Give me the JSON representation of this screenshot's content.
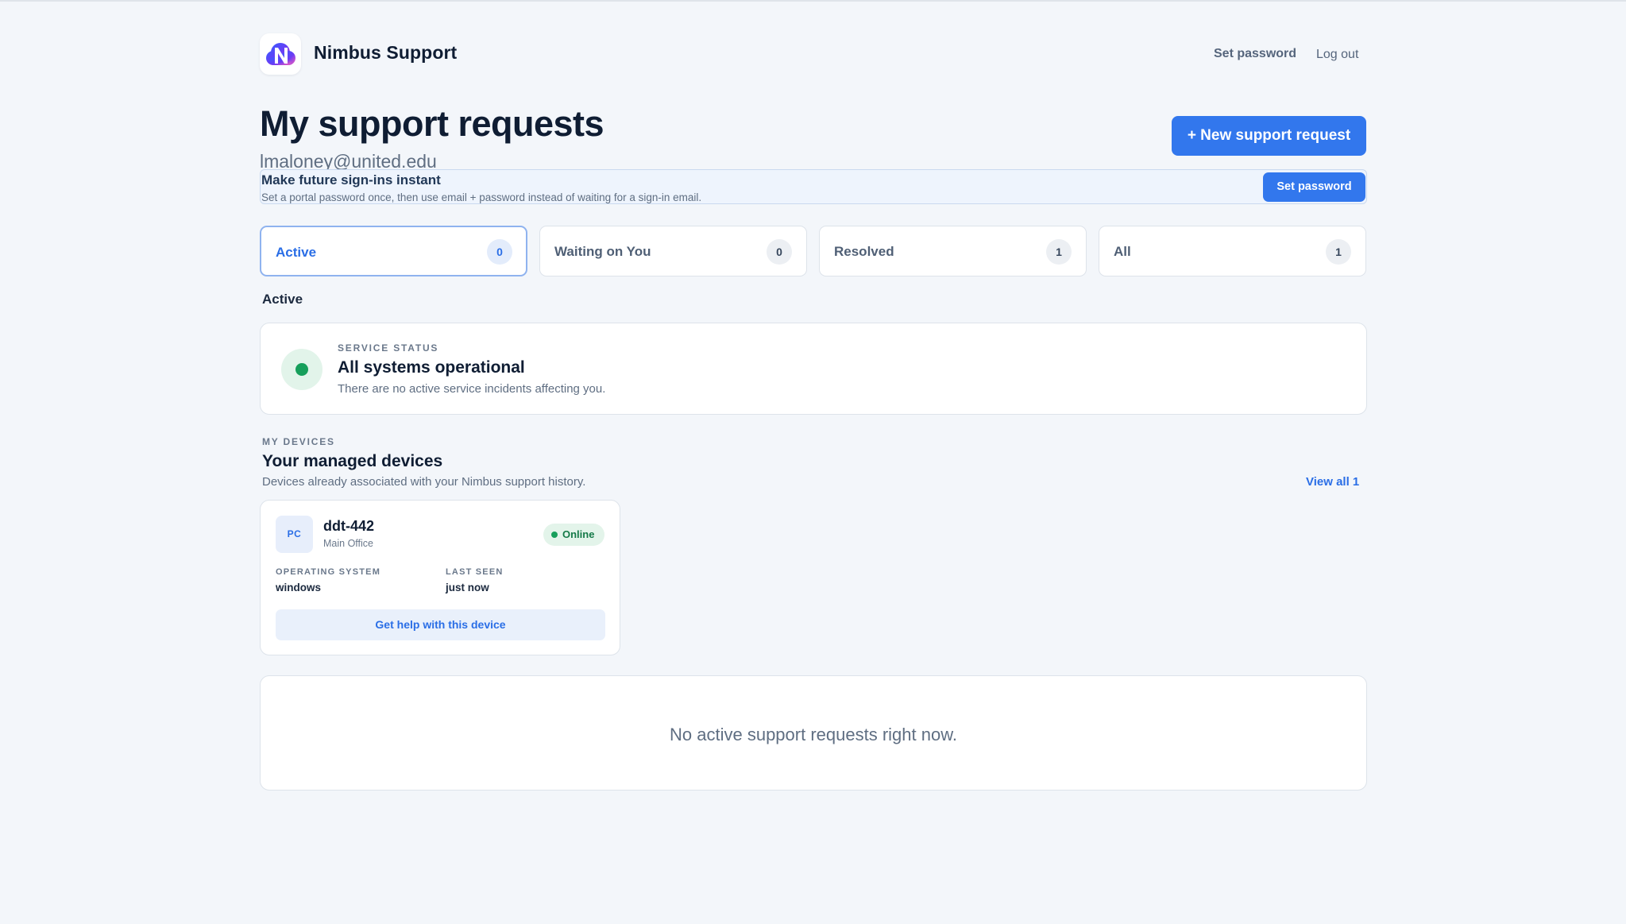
{
  "header": {
    "brand": "Nimbus Support",
    "logo_icon": "nimbus-logo-icon",
    "nav": {
      "set_password": "Set password",
      "log_out": "Log out"
    }
  },
  "page": {
    "title": "My support requests",
    "email": "lmaloney@united.edu",
    "new_request_label": "+ New support request"
  },
  "banner": {
    "title": "Make future sign-ins instant",
    "text": "Set a portal password once, then use email + password instead of waiting for a sign-in email.",
    "button": "Set password"
  },
  "tabs": [
    {
      "label": "Active",
      "count": "0",
      "selected": true
    },
    {
      "label": "Waiting on You",
      "count": "0",
      "selected": false
    },
    {
      "label": "Resolved",
      "count": "1",
      "selected": false
    },
    {
      "label": "All",
      "count": "1",
      "selected": false
    }
  ],
  "active_section_label": "Active",
  "service_status": {
    "eyebrow": "SERVICE STATUS",
    "title": "All systems operational",
    "text": "There are no active service incidents affecting you.",
    "color": "#169f5b"
  },
  "devices": {
    "eyebrow": "MY DEVICES",
    "title": "Your managed devices",
    "subtitle": "Devices already associated with your Nimbus support history.",
    "view_all": "View all 1",
    "items": [
      {
        "icon_text": "PC",
        "name": "ddt-442",
        "location": "Main Office",
        "status": "Online",
        "os_label": "OPERATING SYSTEM",
        "os_value": "windows",
        "last_seen_label": "LAST SEEN",
        "last_seen_value": "just now",
        "help_button": "Get help with this device"
      }
    ]
  },
  "empty_state": {
    "text": "No active support requests right now."
  },
  "colors": {
    "accent": "#3277ed",
    "background": "#f3f6fa",
    "success": "#169f5b"
  }
}
